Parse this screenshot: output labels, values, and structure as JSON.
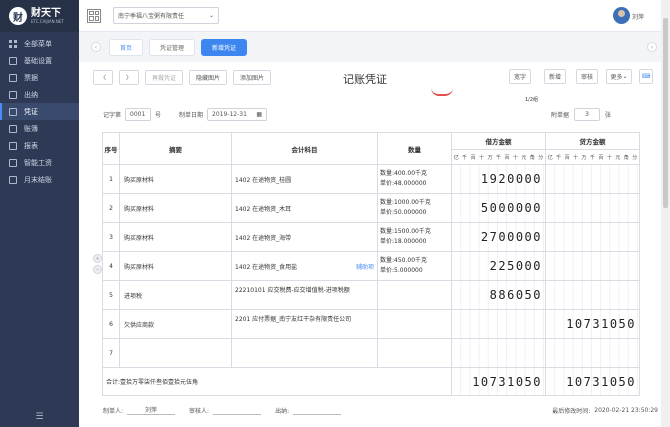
{
  "app": {
    "logo_main": "财天下",
    "logo_sub": "ETC.CAIJIAN.NET"
  },
  "sidebar": {
    "items": [
      {
        "label": "全部菜单",
        "icon": "grid-icon"
      },
      {
        "label": "基础设置",
        "icon": "settings-icon"
      },
      {
        "label": "票据",
        "icon": "receipt-icon"
      },
      {
        "label": "出纳",
        "icon": "cashier-icon"
      },
      {
        "label": "凭证",
        "icon": "voucher-icon"
      },
      {
        "label": "账簿",
        "icon": "ledger-icon"
      },
      {
        "label": "报表",
        "icon": "report-icon"
      },
      {
        "label": "智能工资",
        "icon": "salary-icon"
      },
      {
        "label": "月末结账",
        "icon": "closing-icon"
      }
    ]
  },
  "header": {
    "company": "南宁季福八宝粥有限责任",
    "user": "刘萍"
  },
  "tabs": [
    {
      "label": "首页"
    },
    {
      "label": "凭证管理"
    },
    {
      "label": "新增凭证"
    }
  ],
  "toolbar": {
    "prev": "〈",
    "next": "〉",
    "copy": "再做凭证",
    "hide": "隐藏图片",
    "add_image": "添加图片",
    "title": "记账凭证",
    "font": "宽字",
    "add": "新增",
    "audit": "审核",
    "more": "更多"
  },
  "voucher": {
    "type_label": "记字第",
    "number": "0001",
    "num_suffix": "号",
    "date_label": "制单日期",
    "date": "2019-12-31",
    "page": "1/2组",
    "attach_label": "附单据",
    "attach_count": "3",
    "attach_unit": "张"
  },
  "table": {
    "headers": {
      "seq": "序号",
      "summary": "摘要",
      "subject": "会计科目",
      "qty": "数量",
      "debit": "借方金额",
      "credit": "贷方金额"
    },
    "units": [
      "亿",
      "千",
      "百",
      "十",
      "万",
      "千",
      "百",
      "十",
      "元",
      "角",
      "分"
    ],
    "assist_label": "辅助项",
    "rows": [
      {
        "seq": "1",
        "summary": "购买原材料",
        "subject": "1402 在途物资_桂圆",
        "qty1": "数量:400.00千克",
        "qty2": "单价:48.000000",
        "debit": "1920000",
        "credit": ""
      },
      {
        "seq": "2",
        "summary": "购买原材料",
        "subject": "1402 在途物资_木耳",
        "qty1": "数量:1000.00千克",
        "qty2": "单价:50.000000",
        "debit": "5000000",
        "credit": ""
      },
      {
        "seq": "3",
        "summary": "购买原材料",
        "subject": "1402 在途物资_海带",
        "qty1": "数量:1500.00千克",
        "qty2": "单价:18.000000",
        "debit": "2700000",
        "credit": ""
      },
      {
        "seq": "4",
        "summary": "购买原材料",
        "subject": "1402 在途物资_食用盐",
        "qty1": "数量:450.00千克",
        "qty2": "单价:5.000000",
        "debit": "225000",
        "credit": ""
      },
      {
        "seq": "5",
        "summary": "进项税",
        "subject": "22210101 应交税费-应交增值税-进项税额",
        "qty1": "",
        "qty2": "",
        "debit": "886050",
        "credit": ""
      },
      {
        "seq": "6",
        "summary": "欠供应商款",
        "subject": "2201 应付票据_南宁友红干杂有限责任公司",
        "qty1": "",
        "qty2": "",
        "debit": "",
        "credit": "10731050"
      },
      {
        "seq": "7",
        "summary": "",
        "subject": "",
        "qty1": "",
        "qty2": "",
        "debit": "",
        "credit": ""
      }
    ],
    "total_label": "合计:壹拾万零柒仟叁佰壹拾元伍角",
    "total_debit": "10731050",
    "total_credit": "10731050"
  },
  "footer": {
    "maker_label": "制单人:",
    "maker": "刘萍",
    "auditor_label": "审核人:",
    "auditor": "",
    "cashier_label": "出纳:",
    "cashier": "",
    "modified_label": "最后修改时间:",
    "modified": "2020-02-21 23:50:29"
  }
}
